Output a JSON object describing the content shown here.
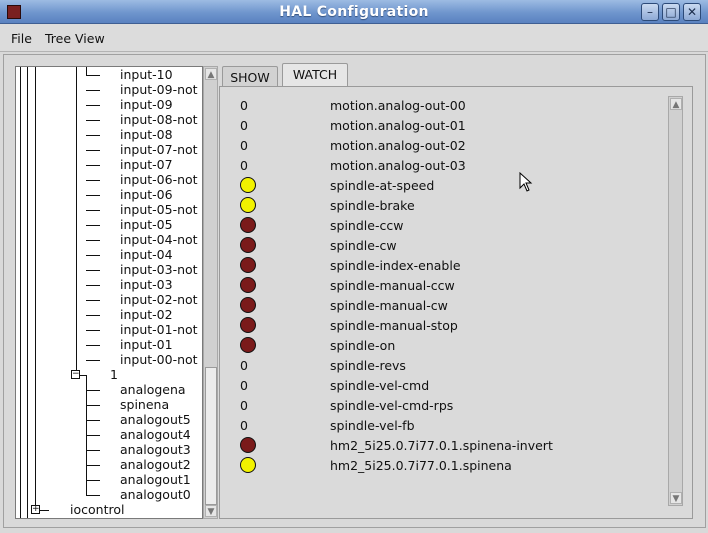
{
  "window": {
    "title": "HAL Configuration"
  },
  "menu": {
    "file": "File",
    "tree_view": "Tree View"
  },
  "tree": {
    "items": [
      "input-10",
      "input-09-not",
      "input-09",
      "input-08-not",
      "input-08",
      "input-07-not",
      "input-07",
      "input-06-not",
      "input-06",
      "input-05-not",
      "input-05",
      "input-04-not",
      "input-04",
      "input-03-not",
      "input-03",
      "input-02-not",
      "input-02",
      "input-01-not",
      "input-01",
      "input-00-not"
    ],
    "node_1": "1",
    "node_1_items": [
      "analogena",
      "spinena",
      "analogout5",
      "analogout4",
      "analogout3",
      "analogout2",
      "analogout1",
      "analogout0"
    ],
    "iocontrol": "iocontrol"
  },
  "tabs": {
    "show": "SHOW",
    "watch": "WATCH"
  },
  "colors": {
    "led_on": "#f2f200",
    "led_off": "#7a1a1a"
  },
  "watch": [
    {
      "kind": "value",
      "value": "0",
      "name": "motion.analog-out-00"
    },
    {
      "kind": "value",
      "value": "0",
      "name": "motion.analog-out-01"
    },
    {
      "kind": "value",
      "value": "0",
      "name": "motion.analog-out-02"
    },
    {
      "kind": "value",
      "value": "0",
      "name": "motion.analog-out-03"
    },
    {
      "kind": "led",
      "state": "on",
      "name": "spindle-at-speed"
    },
    {
      "kind": "led",
      "state": "on",
      "name": "spindle-brake"
    },
    {
      "kind": "led",
      "state": "off",
      "name": "spindle-ccw"
    },
    {
      "kind": "led",
      "state": "off",
      "name": "spindle-cw"
    },
    {
      "kind": "led",
      "state": "off",
      "name": "spindle-index-enable"
    },
    {
      "kind": "led",
      "state": "off",
      "name": "spindle-manual-ccw"
    },
    {
      "kind": "led",
      "state": "off",
      "name": "spindle-manual-cw"
    },
    {
      "kind": "led",
      "state": "off",
      "name": "spindle-manual-stop"
    },
    {
      "kind": "led",
      "state": "off",
      "name": "spindle-on"
    },
    {
      "kind": "value",
      "value": "0",
      "name": "spindle-revs"
    },
    {
      "kind": "value",
      "value": "0",
      "name": "spindle-vel-cmd"
    },
    {
      "kind": "value",
      "value": "0",
      "name": "spindle-vel-cmd-rps"
    },
    {
      "kind": "value",
      "value": "0",
      "name": "spindle-vel-fb"
    },
    {
      "kind": "led",
      "state": "off",
      "name": "hm2_5i25.0.7i77.0.1.spinena-invert"
    },
    {
      "kind": "led",
      "state": "on",
      "name": "hm2_5i25.0.7i77.0.1.spinena"
    }
  ]
}
